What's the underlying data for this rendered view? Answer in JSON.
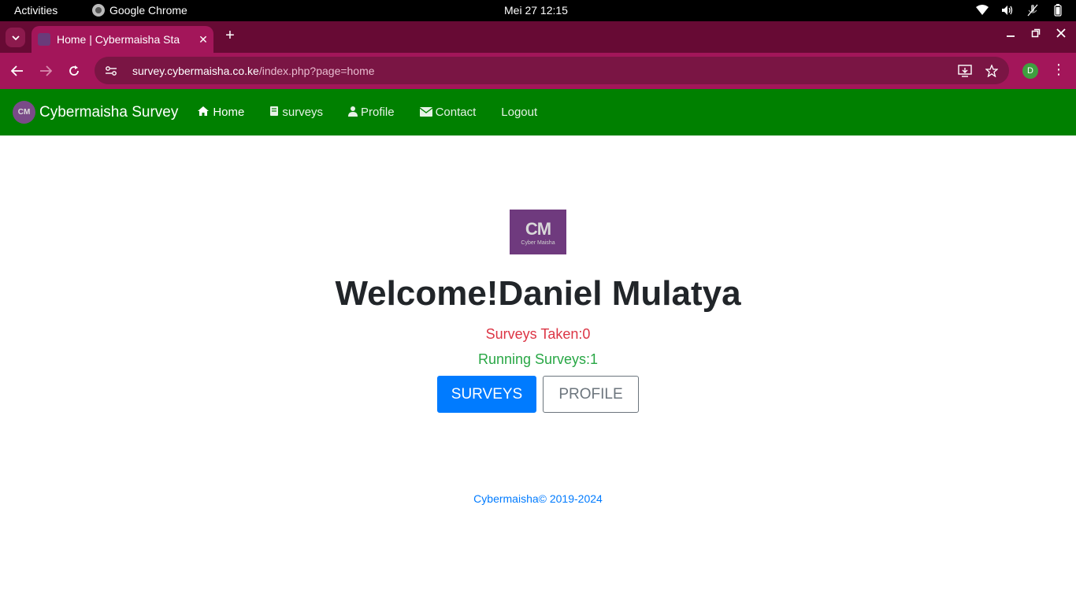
{
  "system_bar": {
    "activities": "Activities",
    "app_name": "Google Chrome",
    "clock": "Mei 27  12:15"
  },
  "browser": {
    "tab_title": "Home | Cybermaisha Sta",
    "url_host": "survey.cybermaisha.co.ke",
    "url_path": "/index.php?page=home",
    "profile_initial": "D",
    "colors": {
      "tabstrip": "#670a34",
      "toolbar": "#a3165a"
    }
  },
  "navbar": {
    "brand": "Cybermaisha Survey",
    "brand_logo_text": "CM",
    "links": [
      {
        "label": "Home",
        "icon": "home-icon"
      },
      {
        "label": "surveys",
        "icon": "book-icon"
      },
      {
        "label": "Profile",
        "icon": "user-icon"
      },
      {
        "label": "Contact",
        "icon": "envelope-icon"
      },
      {
        "label": "Logout"
      }
    ],
    "color": "#008000"
  },
  "main": {
    "logo_text": "CM",
    "logo_subtext": "Cyber Maisha",
    "welcome": "Welcome!Daniel Mulatya",
    "surveys_taken": "Surveys Taken:0",
    "running_surveys": "Running Surveys:1",
    "buttons": {
      "surveys": "SURVEYS",
      "profile": "PROFILE"
    }
  },
  "footer": {
    "text": "Cybermaisha© 2019-2024"
  }
}
